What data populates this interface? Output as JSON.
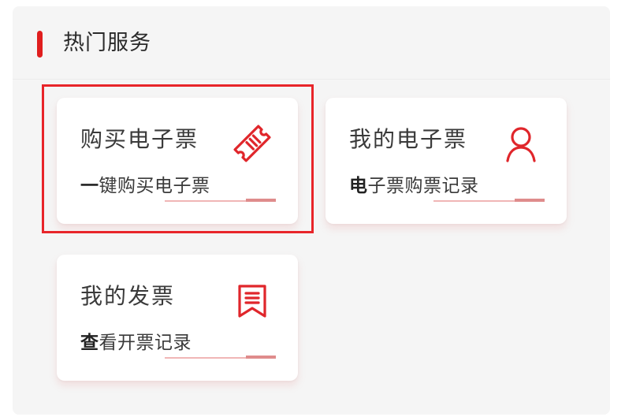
{
  "section": {
    "title": "热门服务"
  },
  "cards": [
    {
      "title": "购买电子票",
      "subtitle": "一键购买电子票",
      "icon": "ticket-icon"
    },
    {
      "title": "我的电子票",
      "subtitle": "电子票购票记录",
      "icon": "user-icon"
    },
    {
      "title": "我的发票",
      "subtitle": "查看开票记录",
      "icon": "bookmark-list-icon"
    }
  ],
  "colors": {
    "accent": "#e01e1e",
    "icon": "#e0262b",
    "underline_light": "#f0b6b6",
    "underline_dark": "#df8c8c",
    "highlight": "#e8252a"
  }
}
